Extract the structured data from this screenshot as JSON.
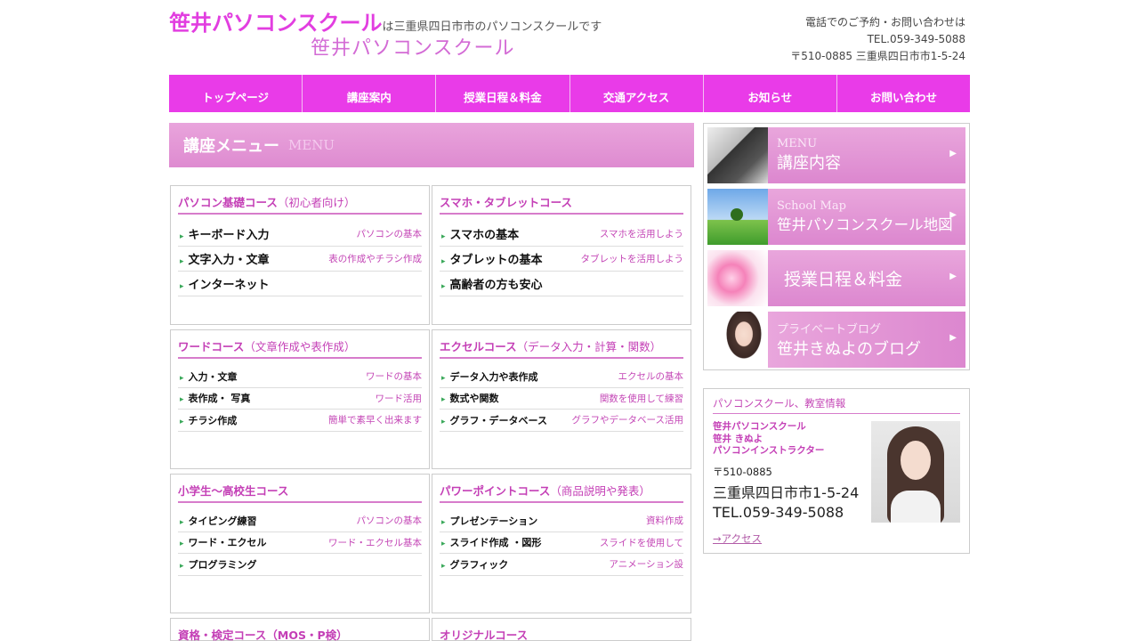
{
  "header": {
    "site_name": "笹井パソコンスクール",
    "tagline": "は三重県四日市市のパソコンスクールです",
    "logo_text": "笹井パソコンスクール",
    "contact_label": "電話でのご予約・お問い合わせは",
    "tel": "TEL.059-349-5088",
    "address": "〒510-0885 三重県四日市市1-5-24"
  },
  "nav": [
    "トップページ",
    "講座案内",
    "授業日程＆料金",
    "交通アクセス",
    "お知らせ",
    "お問い合わせ"
  ],
  "section": {
    "title": "講座メニュー",
    "title_en": "MENU"
  },
  "courses": [
    {
      "title": "パソコン基礎コース",
      "sub": "（初心者向け）",
      "items": [
        {
          "label": "キーボード入力",
          "note": "パソコンの基本"
        },
        {
          "label": "文字入力・文章",
          "note": "表の作成やチラシ作成"
        },
        {
          "label": "インターネット",
          "note": ""
        }
      ]
    },
    {
      "title": "スマホ・タブレットコース",
      "sub": "",
      "items": [
        {
          "label": "スマホの基本",
          "note": "スマホを活用しよう"
        },
        {
          "label": "タブレットの基本",
          "note": "タブレットを活用しよう"
        },
        {
          "label": "高齢者の方も安心",
          "note": ""
        }
      ]
    },
    {
      "title": "ワードコース",
      "sub": "（文章作成や表作成）",
      "items": [
        {
          "label": "入力・文章",
          "note": "ワードの基本"
        },
        {
          "label": "表作成・ 写真",
          "note": "ワード活用"
        },
        {
          "label": "チラシ作成",
          "note": "簡単で素早く出来ます"
        }
      ]
    },
    {
      "title": "エクセルコース",
      "sub": "（データ入力・計算・関数）",
      "items": [
        {
          "label": "データ入力や表作成",
          "note": "エクセルの基本"
        },
        {
          "label": "数式や関数",
          "note": "関数を使用して練習"
        },
        {
          "label": "グラフ・データベース",
          "note": "グラフやデータベース活用"
        }
      ]
    },
    {
      "title": "小学生〜高校生コース",
      "sub": "",
      "items": [
        {
          "label": "タイピング練習",
          "note": "パソコンの基本"
        },
        {
          "label": "ワード・エクセル",
          "note": "ワード・エクセル基本"
        },
        {
          "label": "プログラミング",
          "note": ""
        }
      ]
    },
    {
      "title": "パワーポイントコース",
      "sub": "（商品説明や発表）",
      "items": [
        {
          "label": "プレゼンテーション",
          "note": "資料作成"
        },
        {
          "label": "スライド作成 ・図形",
          "note": "スライドを使用して"
        },
        {
          "label": "グラフィック",
          "note": "アニメーション設"
        }
      ]
    },
    {
      "title": "資格・検定コース（MOS・P検）",
      "sub": "",
      "items": []
    },
    {
      "title": "オリジナルコース",
      "sub": "",
      "items": []
    }
  ],
  "banners": [
    {
      "en": "MENU",
      "ja": "講座内容",
      "icon": "laptop-photo"
    },
    {
      "en": "School Map",
      "ja": "笹井パソコンスクール地図",
      "icon": "tree-photo"
    },
    {
      "en": "",
      "ja": "授業日程＆料金",
      "icon": "flower-photo"
    },
    {
      "en": "プライベートブログ",
      "ja": "笹井きぬよのブログ",
      "icon": "portrait-photo"
    }
  ],
  "info": {
    "heading": "パソコンスクール、教室情報",
    "school": "笹井パソコンスクール",
    "person": "笹井 きぬよ",
    "role": "パソコンインストラクター",
    "zip": "〒510-0885",
    "address": "三重県四日市市1-5-24",
    "tel": "TEL.059-349-5088",
    "access_link": "→アクセス"
  },
  "colors": {
    "accent": "#e93be8",
    "pink_text": "#c447b6",
    "banner": "#de8bd0"
  }
}
